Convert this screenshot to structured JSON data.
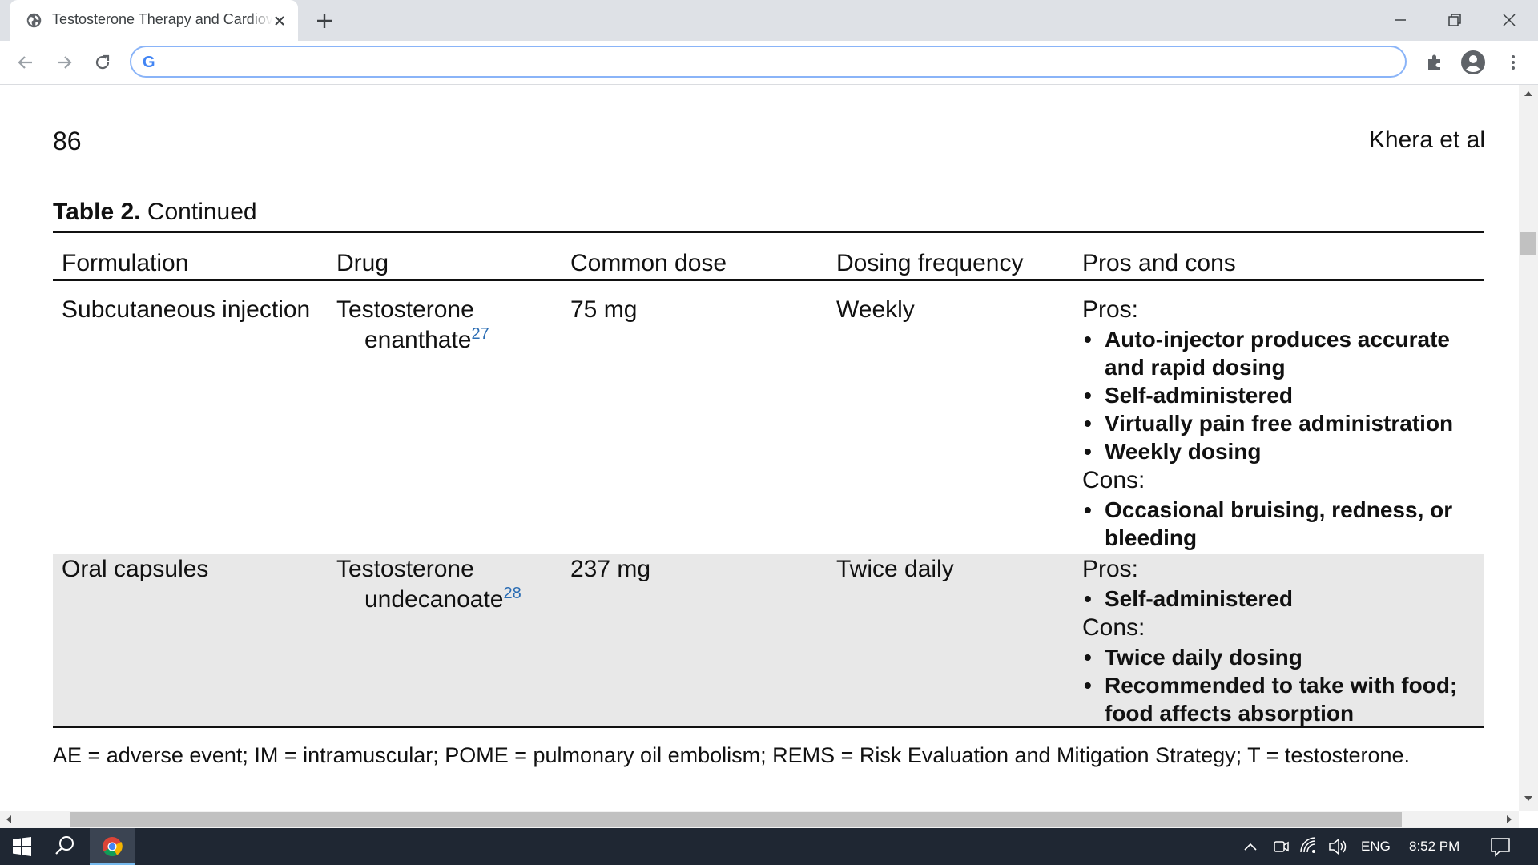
{
  "browser": {
    "tab_title": "Testosterone Therapy and Cardiovascular Risk",
    "address_value": "",
    "address_placeholder": "",
    "google_glyph": "G"
  },
  "page": {
    "page_number": "86",
    "running_head": "Khera et al",
    "caption_bold": "Table 2.",
    "caption_rest": " Continued",
    "columns": [
      "Formulation",
      "Drug",
      "Common dose",
      "Dosing frequency",
      "Pros and cons"
    ],
    "rows": [
      {
        "formulation": "Subcutaneous injection",
        "drug_line1": "Testosterone",
        "drug_line2": "enanthate",
        "drug_ref": "27",
        "dose": "75 mg",
        "frequency": "Weekly",
        "pros_label": "Pros:",
        "pros": [
          "Auto-injector produces accurate and rapid dosing",
          "Self-administered",
          "Virtually pain free administration",
          "Weekly dosing"
        ],
        "cons_label": "Cons:",
        "cons": [
          "Occasional bruising, redness, or bleeding"
        ]
      },
      {
        "formulation": "Oral capsules",
        "drug_line1": "Testosterone",
        "drug_line2": "undecanoate",
        "drug_ref": "28",
        "dose": "237 mg",
        "frequency": "Twice daily",
        "pros_label": "Pros:",
        "pros": [
          "Self-administered"
        ],
        "cons_label": "Cons:",
        "cons": [
          "Twice daily dosing",
          "Recommended to take with food; food affects absorption"
        ]
      }
    ],
    "footnote": "AE = adverse event; IM = intramuscular; POME = pulmonary oil embolism; REMS = Risk Evaluation and Mitigation Strategy; T = testosterone."
  },
  "taskbar": {
    "language": "ENG",
    "time": "8:52 PM"
  },
  "colors": {
    "tabstrip": "#dee1e6",
    "omnibox_focus": "#8ab4f8",
    "reference_link": "#2a6cb3",
    "shaded_row": "#e8e8e8",
    "taskbar": "#1f2733",
    "active_app_underline": "#76b9ed"
  },
  "icons": [
    "globe-icon",
    "close-icon",
    "plus-icon",
    "minimize-icon",
    "restore-icon",
    "back-arrow-icon",
    "forward-arrow-icon",
    "reload-icon",
    "google-icon",
    "puzzle-extensions-icon",
    "profile-icon",
    "kebab-menu-icon",
    "windows-start-icon",
    "search-icon",
    "chrome-icon",
    "chevron-up-icon",
    "meet-now-icon",
    "wifi-icon",
    "speaker-icon",
    "notification-icon"
  ]
}
